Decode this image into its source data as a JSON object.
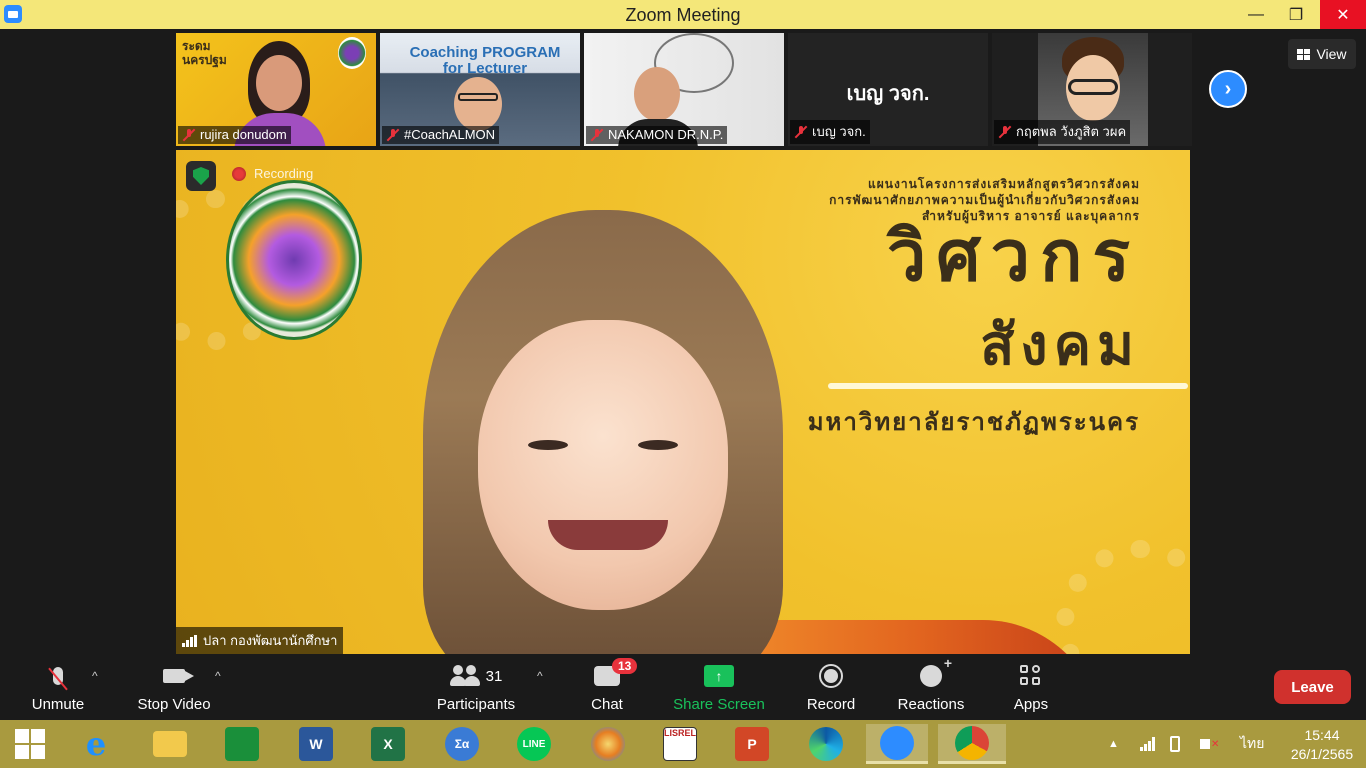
{
  "window": {
    "title": "Zoom Meeting",
    "minimize_glyph": "—",
    "maximize_glyph": "❐",
    "close_glyph": "✕"
  },
  "thumbnails": [
    {
      "name": "rujira donudom",
      "muted": true
    },
    {
      "name": "#CoachALMON",
      "muted": true,
      "overlay_text": "Coaching PROGRAM for Lecturer"
    },
    {
      "name": "NAKAMON DR.N.P.",
      "muted": true
    },
    {
      "name": "เบญ วจก.",
      "muted": true,
      "center_text": "เบญ วจก."
    },
    {
      "name": "กฤตพล วังภูสิต วผค",
      "muted": true
    }
  ],
  "thumbnail_badge_text": "ระดม นครปฐม",
  "view_button": {
    "label": "View",
    "icon": "grid-icon"
  },
  "next_button": {
    "icon": "chevron-right-icon",
    "glyph": "›"
  },
  "speaker": {
    "name": "ปลา กองพัฒนานักศึกษา",
    "recording_label": "Recording",
    "slide": {
      "subtitle_lines": [
        "แผนงานโครงการส่งเสริมหลักสูตรวิศวกรสังคม",
        "การพัฒนาศักยภาพความเป็นผู้นำเกี่ยวกับวิศวกรสังคม",
        "สำหรับผู้บริหาร อาจารย์ และบุคลากร"
      ],
      "title_line1": "วิศวกร",
      "title_line2": "สังคม",
      "university": "มหาวิทยาลัยราชภัฏพระนคร"
    }
  },
  "toolbar": {
    "unmute": {
      "label": "Unmute",
      "icon": "mic-off-icon"
    },
    "stop_video": {
      "label": "Stop Video",
      "icon": "video-camera-icon"
    },
    "participants": {
      "label": "Participants",
      "count": "31",
      "icon": "participants-icon"
    },
    "chat": {
      "label": "Chat",
      "badge": "13",
      "icon": "chat-icon"
    },
    "share_screen": {
      "label": "Share Screen",
      "icon": "share-screen-icon",
      "glyph": "↑",
      "color": "#19c15b"
    },
    "record": {
      "label": "Record",
      "icon": "record-icon"
    },
    "reactions": {
      "label": "Reactions",
      "icon": "reactions-icon"
    },
    "apps": {
      "label": "Apps",
      "icon": "apps-icon"
    },
    "leave": {
      "label": "Leave",
      "color": "#d0312d"
    },
    "caret_glyph": "^"
  },
  "taskbar": {
    "apps": [
      {
        "name": "start",
        "icon": "windows-icon"
      },
      {
        "name": "internet-explorer",
        "icon": "ie-icon",
        "glyph": "e"
      },
      {
        "name": "file-explorer",
        "icon": "folder-icon"
      },
      {
        "name": "store",
        "icon": "store-icon"
      },
      {
        "name": "word",
        "icon": "word-icon",
        "glyph": "W"
      },
      {
        "name": "excel",
        "icon": "excel-icon",
        "glyph": "X"
      },
      {
        "name": "math",
        "icon": "math-icon",
        "glyph": "Σα"
      },
      {
        "name": "line",
        "icon": "line-icon",
        "glyph": "LINE"
      },
      {
        "name": "paint",
        "icon": "paint-icon"
      },
      {
        "name": "lisrel",
        "icon": "lisrel-icon",
        "glyph": "LISREL"
      },
      {
        "name": "powerpoint",
        "icon": "powerpoint-icon",
        "glyph": "P"
      },
      {
        "name": "edge",
        "icon": "edge-icon"
      },
      {
        "name": "zoom",
        "icon": "zoom-icon"
      },
      {
        "name": "chrome",
        "icon": "chrome-icon"
      }
    ],
    "tray": {
      "language": "ไทย",
      "time": "15:44",
      "date": "26/1/2565"
    }
  }
}
